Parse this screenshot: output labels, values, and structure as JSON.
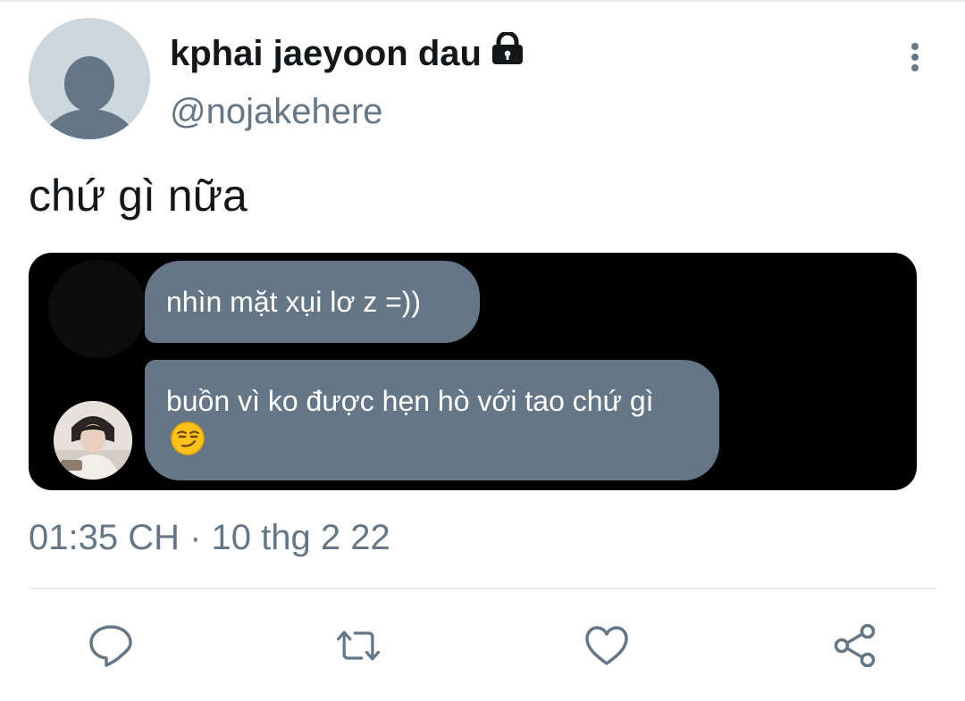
{
  "tweet": {
    "author": {
      "display_name": "kphai jaeyoon dau",
      "handle": "@nojakehere",
      "protected_icon": "lock-icon"
    },
    "text": "chứ gì nữa",
    "timestamp": "01:35 CH · 10 thg 2 22"
  },
  "media": {
    "messages": [
      {
        "text": "nhìn mặt xụi lơ z =))"
      },
      {
        "text": "buồn vì ko được hẹn hò với tao chứ gì",
        "emoji": "smirking-face-emoji"
      }
    ]
  },
  "actions": [
    {
      "name": "reply",
      "icon": "comment-icon"
    },
    {
      "name": "retweet",
      "icon": "retweet-icon"
    },
    {
      "name": "like",
      "icon": "heart-icon"
    },
    {
      "name": "share",
      "icon": "share-icon"
    }
  ],
  "colors": {
    "text_primary": "#14171a",
    "text_secondary": "#657786",
    "bubble": "#657786",
    "media_background": "#000000",
    "divider": "#e6ecf0",
    "avatar_placeholder": "#ccd6dd"
  }
}
